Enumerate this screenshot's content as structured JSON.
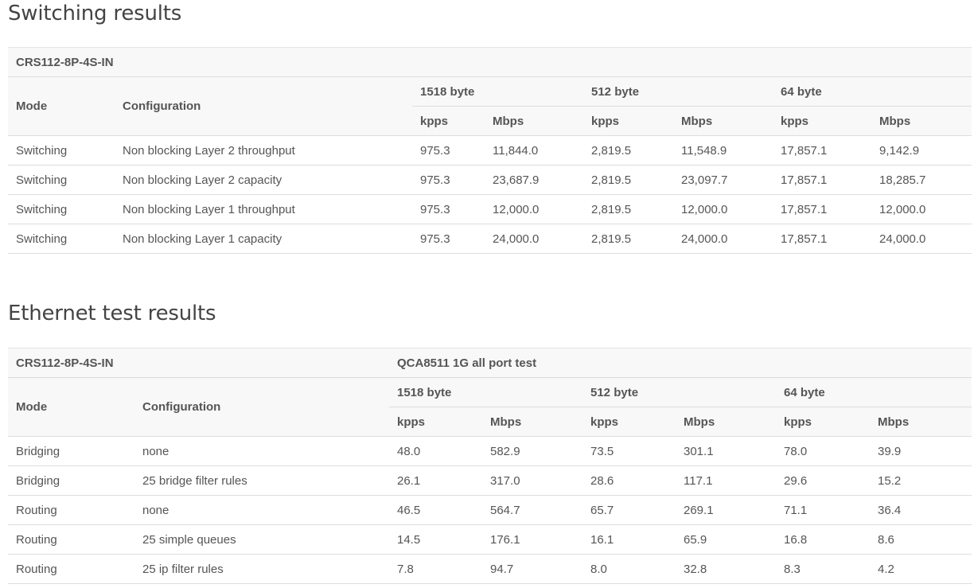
{
  "switching": {
    "title": "Switching results",
    "model": "CRS112-8P-4S-IN",
    "headers": {
      "mode": "Mode",
      "configuration": "Configuration",
      "sizes": [
        "1518 byte",
        "512 byte",
        "64 byte"
      ],
      "units": [
        "kpps",
        "Mbps",
        "kpps",
        "Mbps",
        "kpps",
        "Mbps"
      ]
    },
    "rows": [
      {
        "mode": "Switching",
        "config": "Non blocking Layer 2 throughput",
        "values": [
          "975.3",
          "11,844.0",
          "2,819.5",
          "11,548.9",
          "17,857.1",
          "9,142.9"
        ]
      },
      {
        "mode": "Switching",
        "config": "Non blocking Layer 2 capacity",
        "values": [
          "975.3",
          "23,687.9",
          "2,819.5",
          "23,097.7",
          "17,857.1",
          "18,285.7"
        ]
      },
      {
        "mode": "Switching",
        "config": "Non blocking Layer 1 throughput",
        "values": [
          "975.3",
          "12,000.0",
          "2,819.5",
          "12,000.0",
          "17,857.1",
          "12,000.0"
        ]
      },
      {
        "mode": "Switching",
        "config": "Non blocking Layer 1 capacity",
        "values": [
          "975.3",
          "24,000.0",
          "2,819.5",
          "24,000.0",
          "17,857.1",
          "24,000.0"
        ]
      }
    ]
  },
  "ethernet": {
    "title": "Ethernet test results",
    "model": "CRS112-8P-4S-IN",
    "test_name": "QCA8511 1G all port test",
    "headers": {
      "mode": "Mode",
      "configuration": "Configuration",
      "sizes": [
        "1518 byte",
        "512 byte",
        "64 byte"
      ],
      "units": [
        "kpps",
        "Mbps",
        "kpps",
        "Mbps",
        "kpps",
        "Mbps"
      ]
    },
    "rows": [
      {
        "mode": "Bridging",
        "config": "none",
        "values": [
          "48.0",
          "582.9",
          "73.5",
          "301.1",
          "78.0",
          "39.9"
        ]
      },
      {
        "mode": "Bridging",
        "config": "25 bridge filter rules",
        "values": [
          "26.1",
          "317.0",
          "28.6",
          "117.1",
          "29.6",
          "15.2"
        ]
      },
      {
        "mode": "Routing",
        "config": "none",
        "values": [
          "46.5",
          "564.7",
          "65.7",
          "269.1",
          "71.1",
          "36.4"
        ]
      },
      {
        "mode": "Routing",
        "config": "25 simple queues",
        "values": [
          "14.5",
          "176.1",
          "16.1",
          "65.9",
          "16.8",
          "8.6"
        ]
      },
      {
        "mode": "Routing",
        "config": "25 ip filter rules",
        "values": [
          "7.8",
          "94.7",
          "8.0",
          "32.8",
          "8.3",
          "4.2"
        ]
      }
    ]
  }
}
